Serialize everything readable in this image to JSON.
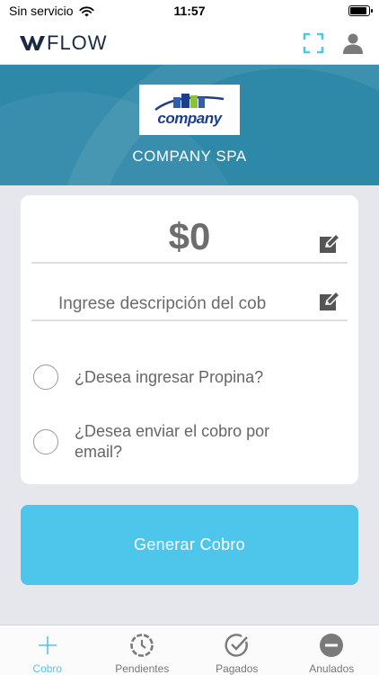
{
  "status_bar": {
    "carrier": "Sin servicio",
    "time": "11:57",
    "battery_level": 0.9
  },
  "nav": {
    "logo_text": "FLOW",
    "scan_icon": "scan-icon",
    "profile_icon": "user-icon"
  },
  "header": {
    "company_logo_text": "company",
    "company_name": "COMPANY SPA"
  },
  "form": {
    "amount": "$0",
    "description_placeholder": "Ingrese descripción del cob",
    "options": [
      {
        "label": "¿Desea ingresar Propina?",
        "checked": false
      },
      {
        "label": "¿Desea enviar el cobro por email?",
        "checked": false
      }
    ]
  },
  "actions": {
    "generate_label": "Generar Cobro"
  },
  "tabs": [
    {
      "label": "Cobro",
      "icon": "plus-icon",
      "active": true
    },
    {
      "label": "Pendientes",
      "icon": "clock-icon",
      "active": false
    },
    {
      "label": "Pagados",
      "icon": "check-circle-icon",
      "active": false
    },
    {
      "label": "Anulados",
      "icon": "minus-circle-icon",
      "active": false
    }
  ],
  "colors": {
    "accent": "#4ec6ec",
    "header_bg": "#2e88a8",
    "page_bg": "#e6e7ec"
  }
}
